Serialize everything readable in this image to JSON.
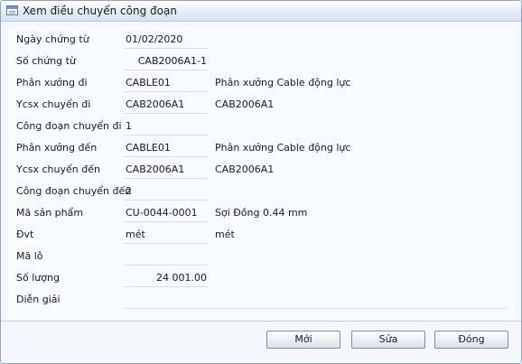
{
  "window": {
    "title": "Xem điều chuyển công đoạn",
    "icon": "form-window-icon"
  },
  "fields": {
    "ngay_chung_tu": {
      "label": "Ngày chứng từ",
      "value": "01/02/2020"
    },
    "so_chung_tu": {
      "label": "Số chứng từ",
      "value": "CAB2006A1-1"
    },
    "phan_xuong_di": {
      "label": "Phân xưởng đi",
      "value": "CABLE01",
      "desc": "Phân xưởng Cable động lực"
    },
    "ycsx_chuyen_di": {
      "label": "Ycsx chuyển đi",
      "value": "CAB2006A1",
      "desc": "CAB2006A1"
    },
    "cong_doan_chuyen_di": {
      "label": "Công đoạn chuyển đi",
      "value": "1"
    },
    "phan_xuong_den": {
      "label": "Phân xưởng đến",
      "value": "CABLE01",
      "desc": "Phân xưởng Cable động lực"
    },
    "ycsx_chuyen_den": {
      "label": "Ycsx chuyển đến",
      "value": "CAB2006A1",
      "desc": "CAB2006A1"
    },
    "cong_doan_chuyen_den": {
      "label": "Công đoạn chuyển đến",
      "value": "2"
    },
    "ma_san_pham": {
      "label": "Mã sản phẩm",
      "value": "CU-0044-0001",
      "desc": "Sợi Đồng 0.44 mm"
    },
    "dvt": {
      "label": "Đvt",
      "value": "mét",
      "desc": "mét"
    },
    "ma_lo": {
      "label": "Mã lô",
      "value": ""
    },
    "so_luong": {
      "label": "Số lượng",
      "value": "24 001.00"
    },
    "dien_giai": {
      "label": "Diễn giải",
      "value": ""
    }
  },
  "buttons": {
    "new": "Mới",
    "edit": "Sửa",
    "close": "Đóng"
  }
}
